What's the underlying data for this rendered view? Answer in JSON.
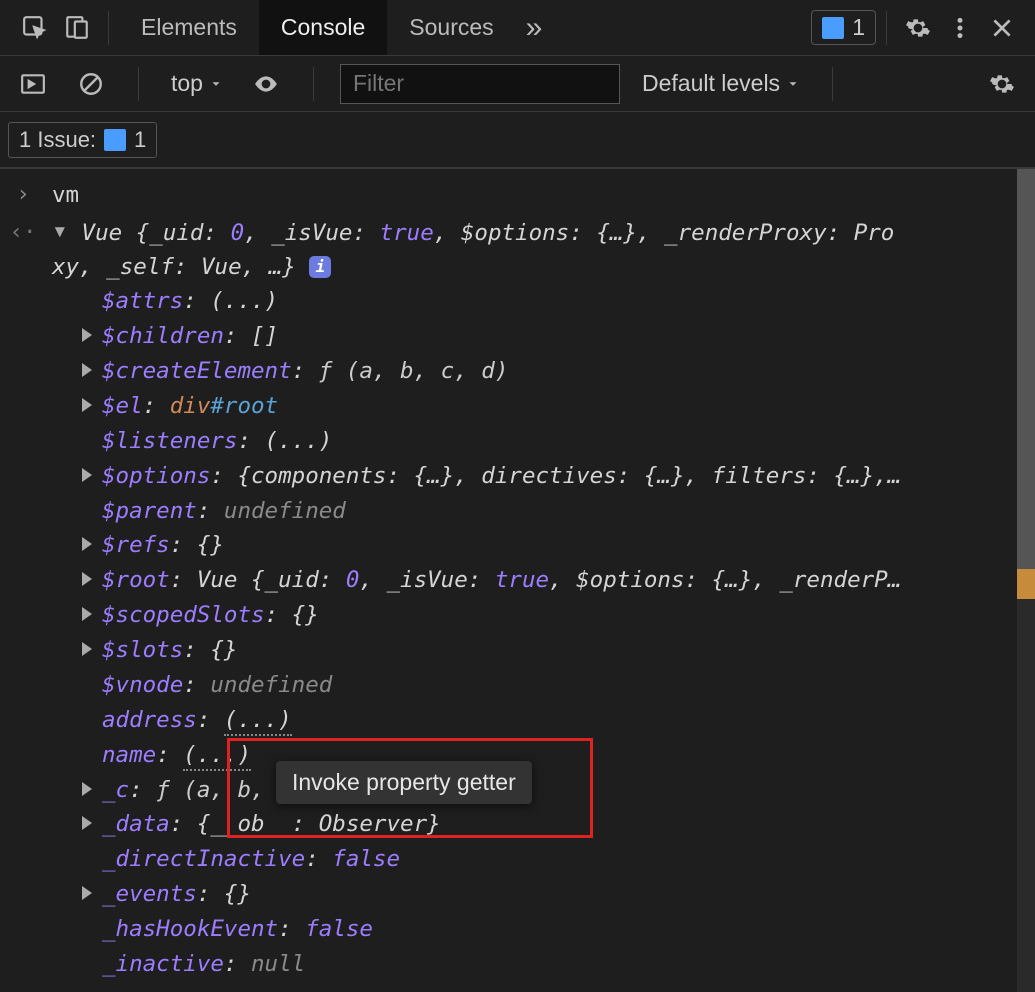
{
  "topBar": {
    "tabs": {
      "elements": "Elements",
      "console": "Console",
      "sources": "Sources"
    },
    "overflow": "»",
    "issuesCount": "1"
  },
  "consoleToolbar": {
    "context": "top",
    "filterPlaceholder": "Filter",
    "levels": "Default levels"
  },
  "issuesRow": {
    "label": "1 Issue:",
    "count": "1"
  },
  "input": {
    "command": "vm"
  },
  "response": {
    "summaryPrefix": "Vue {_uid: ",
    "uid0": "0",
    "sp1": ", _isVue: ",
    "true1": "true",
    "sp2": ", $options: ",
    "opts1": "{…}",
    "sp3": ", _renderProxy: ",
    "proxyLine1End": "Pro",
    "summaryLine2Pre": "xy",
    "sp4": ", _self: Vue, …}",
    "infoBadge": "i"
  },
  "props": {
    "attrs": {
      "key": "$attrs",
      "val": "(...)"
    },
    "children": {
      "key": "$children",
      "val": "[]"
    },
    "createElement": {
      "key": "$createElement",
      "fn": "ƒ",
      "args": "(a, b, c, d)"
    },
    "el": {
      "key": "$el",
      "tag": "div",
      "id": "#root"
    },
    "listeners": {
      "key": "$listeners",
      "val": "(...)"
    },
    "options": {
      "key": "$options",
      "val": "{components: {…}, directives: {…}, filters: {…},…"
    },
    "parent": {
      "key": "$parent",
      "val": "undefined"
    },
    "refs": {
      "key": "$refs",
      "val": "{}"
    },
    "root": {
      "key": "$root",
      "prefix": "Vue {_uid: ",
      "uid": "0",
      "sp1": ", _isVue: ",
      "true": "true",
      "sp2": ", $options: ",
      "opts": "{…}",
      "sp3": ", _renderP…"
    },
    "scopedSlots": {
      "key": "$scopedSlots",
      "val": "{}"
    },
    "slots": {
      "key": "$slots",
      "val": "{}"
    },
    "vnode": {
      "key": "$vnode",
      "val": "undefined"
    },
    "address": {
      "key": "address",
      "val": "(...)"
    },
    "name": {
      "key": "name",
      "val": "(...)"
    },
    "c": {
      "key": "_c",
      "fn": "ƒ",
      "args": "(a, b, c, d)"
    },
    "data": {
      "key": "_data",
      "val": "{__ob__: Observer}"
    },
    "directInactive": {
      "key": "_directInactive",
      "val": "false"
    },
    "events": {
      "key": "_events",
      "val": "{}"
    },
    "hasHookEvent": {
      "key": "_hasHookEvent",
      "val": "false"
    },
    "inactive": {
      "key": "_inactive",
      "val": "null"
    }
  },
  "tooltip": {
    "text": "Invoke property getter"
  }
}
